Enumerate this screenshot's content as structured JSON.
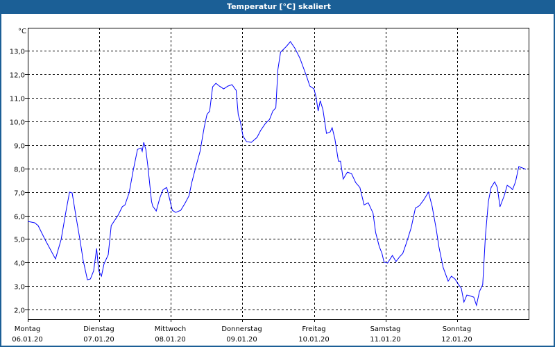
{
  "window": {
    "title": "Temperatur [°C] skaliert"
  },
  "chart_data": {
    "type": "line",
    "title": "Temperatur [°C] skaliert",
    "ylabel": "°C",
    "xlabel": "",
    "x_unit": "hours since Montag 06.01.20 00:00",
    "xlim": [
      0,
      168
    ],
    "ylim": [
      1.59,
      13.98
    ],
    "grid": true,
    "y_ticks": [
      2,
      3,
      4,
      5,
      6,
      7,
      8,
      9,
      10,
      11,
      12,
      13
    ],
    "y_tick_labels": [
      "2,0",
      "3,0",
      "4,0",
      "5,0",
      "6,0",
      "7,0",
      "8,0",
      "9,0",
      "10,0",
      "11,0",
      "12,0",
      "13,0"
    ],
    "x_ticks": [
      {
        "hour": 0,
        "day": "Montag",
        "date": "06.01.20"
      },
      {
        "hour": 24,
        "day": "Dienstag",
        "date": "07.01.20"
      },
      {
        "hour": 48,
        "day": "Mittwoch",
        "date": "08.01.20"
      },
      {
        "hour": 72,
        "day": "Donnerstag",
        "date": "09.01.20"
      },
      {
        "hour": 96,
        "day": "Freitag",
        "date": "10.01.20"
      },
      {
        "hour": 120,
        "day": "Samstag",
        "date": "11.01.20"
      },
      {
        "hour": 144,
        "day": "Sonntag",
        "date": "12.01.20"
      }
    ],
    "series": [
      {
        "name": "Temperatur",
        "color": "#0000ff",
        "x": [
          0,
          2.3,
          3.5,
          5.8,
          9.3,
          11.2,
          12.8,
          14.0,
          14.9,
          16.3,
          17.5,
          18.6,
          20.0,
          21.0,
          22.1,
          23.1,
          23.8,
          24.7,
          25.6,
          27.0,
          28.0,
          30.3,
          31.7,
          32.6,
          34.0,
          35.4,
          36.8,
          38.0,
          38.4,
          38.9,
          39.6,
          40.3,
          41.5,
          41.9,
          43.1,
          44.3,
          45.4,
          46.6,
          47.5,
          48.5,
          49.6,
          51.3,
          52.7,
          54.1,
          55.0,
          56.4,
          57.8,
          59.2,
          60.1,
          61.0,
          62.0,
          63.1,
          64.3,
          65.7,
          67.1,
          68.5,
          69.9,
          70.6,
          71.3,
          72.2,
          73.4,
          75.0,
          76.9,
          78.1,
          79.7,
          81.1,
          82.2,
          83.2,
          83.9,
          84.8,
          86.7,
          88.1,
          89.7,
          91.3,
          92.5,
          93.7,
          94.6,
          96.0,
          96.7,
          97.4,
          98.1,
          99.0,
          100.2,
          101.4,
          102.1,
          103.0,
          104.2,
          104.9,
          105.8,
          107.2,
          108.6,
          110.0,
          111.4,
          112.8,
          114.2,
          115.8,
          116.7,
          117.9,
          118.8,
          119.5,
          120.7,
          122.3,
          123.5,
          124.7,
          125.8,
          127.0,
          128.6,
          130.0,
          131.4,
          132.8,
          134.4,
          135.6,
          137.0,
          137.9,
          139.3,
          141.0,
          142.1,
          143.3,
          144.5,
          145.4,
          146.3,
          147.3,
          148.2,
          149.6,
          150.5,
          151.5,
          152.6,
          153.5,
          154.5,
          155.4,
          156.6,
          157.5,
          158.4,
          159.8,
          160.8,
          161.9,
          162.6,
          163.6,
          164.7,
          165.9,
          167.1
        ],
        "y": [
          5.75,
          5.69,
          5.57,
          4.98,
          4.15,
          4.98,
          6.16,
          6.99,
          6.96,
          5.86,
          4.98,
          4.09,
          3.27,
          3.3,
          3.65,
          4.6,
          3.65,
          3.42,
          3.95,
          4.33,
          5.57,
          6.01,
          6.37,
          6.45,
          6.96,
          7.93,
          8.81,
          8.87,
          8.73,
          9.11,
          8.81,
          8.08,
          6.6,
          6.4,
          6.19,
          6.75,
          7.1,
          7.19,
          6.75,
          6.22,
          6.13,
          6.22,
          6.51,
          6.84,
          7.4,
          8.08,
          8.73,
          9.76,
          10.29,
          10.44,
          11.47,
          11.62,
          11.5,
          11.38,
          11.5,
          11.56,
          11.32,
          10.29,
          9.99,
          9.37,
          9.14,
          9.11,
          9.32,
          9.61,
          9.91,
          10.08,
          10.44,
          10.58,
          12.21,
          12.94,
          13.18,
          13.39,
          13.09,
          12.68,
          12.27,
          11.85,
          11.5,
          11.38,
          11.03,
          10.44,
          10.88,
          10.5,
          9.49,
          9.55,
          9.73,
          9.26,
          8.31,
          8.31,
          7.55,
          7.84,
          7.78,
          7.4,
          7.19,
          6.45,
          6.54,
          6.1,
          5.27,
          4.68,
          4.39,
          4.01,
          3.98,
          4.3,
          4.04,
          4.24,
          4.39,
          4.83,
          5.48,
          6.31,
          6.42,
          6.66,
          6.99,
          6.4,
          5.42,
          4.68,
          3.8,
          3.21,
          3.42,
          3.3,
          3.06,
          2.91,
          2.32,
          2.62,
          2.59,
          2.53,
          2.18,
          2.77,
          3.06,
          5.13,
          6.6,
          7.19,
          7.43,
          7.19,
          6.37,
          6.84,
          7.28,
          7.19,
          7.1,
          7.43,
          8.08,
          8.02,
          7.96
        ]
      }
    ]
  }
}
